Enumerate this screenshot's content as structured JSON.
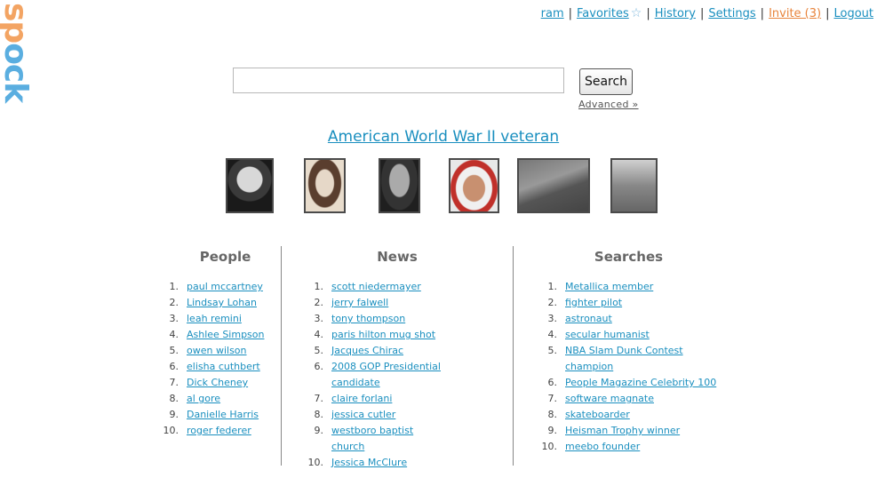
{
  "logo": {
    "part1": "sp",
    "part2": "ock"
  },
  "topnav": {
    "user": "ram",
    "favorites": "Favorites",
    "history": "History",
    "settings": "Settings",
    "invite": "Invite (3)",
    "logout": "Logout",
    "separator": "|"
  },
  "search": {
    "value": "",
    "button_label": "Search",
    "advanced_label": "Advanced »"
  },
  "featured": {
    "title": "American World War II veteran"
  },
  "columns": {
    "people": {
      "title": "People",
      "items": [
        "paul mccartney",
        "Lindsay Lohan",
        "leah remini",
        "Ashlee Simpson",
        "owen wilson",
        "elisha cuthbert",
        "Dick Cheney",
        "al gore",
        "Danielle Harris",
        "roger federer"
      ]
    },
    "news": {
      "title": "News",
      "items": [
        "scott niedermayer",
        "jerry falwell",
        "tony thompson",
        "paris hilton mug shot",
        "Jacques Chirac",
        "2008 GOP Presidential candidate",
        "claire forlani",
        "jessica cutler",
        "westboro baptist church",
        "Jessica McClure"
      ]
    },
    "searches": {
      "title": "Searches",
      "items": [
        "Metallica member",
        "fighter pilot",
        "astronaut",
        "secular humanist",
        "NBA Slam Dunk Contest champion",
        "People Magazine Celebrity 100",
        "software magnate",
        "skateboarder",
        "Heisman Trophy winner",
        "meebo founder"
      ]
    }
  },
  "numbers": [
    "1.",
    "2.",
    "3.",
    "4.",
    "5.",
    "6.",
    "7.",
    "8.",
    "9.",
    "10."
  ],
  "colors": {
    "link": "#1a8fbf",
    "invite": "#e8843c",
    "logo_orange": "#f3a463",
    "logo_blue": "#5aaee0"
  }
}
